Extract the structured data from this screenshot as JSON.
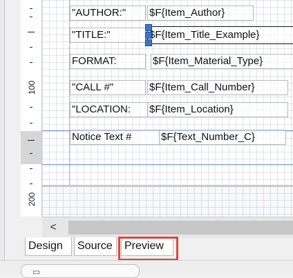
{
  "ruler": {
    "labels": [
      "100",
      "200"
    ]
  },
  "fields": [
    {
      "id": "author-label",
      "text": "\"AUTHOR:\""
    },
    {
      "id": "author-value",
      "text": "$F{Item_Author}"
    },
    {
      "id": "title-label",
      "text": "\"TITLE:\""
    },
    {
      "id": "title-value",
      "text": "$F{Item_Title_Example}"
    },
    {
      "id": "format-label",
      "text": "FORMAT:"
    },
    {
      "id": "format-value",
      "text": "$F{Item_Material_Type}"
    },
    {
      "id": "callno-label",
      "text": "\"CALL #\""
    },
    {
      "id": "callno-value",
      "text": "$F{Item_Call_Number}"
    },
    {
      "id": "location-label",
      "text": "\"LOCATION:"
    },
    {
      "id": "location-value",
      "text": "$F{Item_Location}"
    },
    {
      "id": "notice-label",
      "text": "Notice Text #"
    },
    {
      "id": "notice-value",
      "text": "$F{Text_Number_C}"
    }
  ],
  "scrollbar": {
    "left_arrow": "<"
  },
  "tabs": [
    {
      "label": "Design"
    },
    {
      "label": "Source"
    },
    {
      "label": "Preview"
    }
  ],
  "icons": {
    "scroll_left": "chevron-left-icon",
    "selection_handle": "resize-handle-icon"
  },
  "colors": {
    "highlight": "#e0453b",
    "guide": "#6e8cd8",
    "handle": "#3a76c9"
  }
}
